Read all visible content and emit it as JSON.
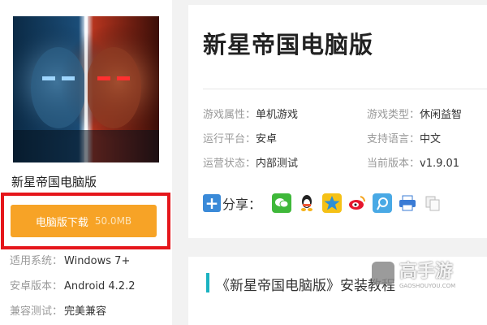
{
  "game": {
    "name_left": "新星帝国电脑版",
    "title": "新星帝国电脑版"
  },
  "download": {
    "label": "电脑版下载",
    "size": "50.0MB"
  },
  "left_info": [
    {
      "key": "适用系统：",
      "value": "Windows 7+"
    },
    {
      "key": "安卓版本：",
      "value": "Android 4.2.2"
    },
    {
      "key": "兼容测试：",
      "value": "完美兼容"
    }
  ],
  "attributes": [
    {
      "key": "游戏属性：",
      "value": "单机游戏"
    },
    {
      "key": "游戏类型：",
      "value": "休闲益智"
    },
    {
      "key": "运行平台：",
      "value": "安卓"
    },
    {
      "key": "支持语言：",
      "value": "中文"
    },
    {
      "key": "运营状态：",
      "value": "内部测试"
    },
    {
      "key": "当前版本：",
      "value": "v1.9.01"
    }
  ],
  "share": {
    "label": "分享：",
    "icons": [
      "wechat-icon",
      "qq-icon",
      "qzone-icon",
      "weibo-icon",
      "tencent-weibo-icon",
      "print-icon",
      "copy-icon"
    ]
  },
  "guide": {
    "title": "《新星帝国电脑版》安装教程"
  },
  "watermark": {
    "cn": "高手游",
    "en": "GAOSHOUYOU.COM"
  },
  "colors": {
    "download_bg": "#f7a326",
    "highlight_border": "#e5161b",
    "accent": "#1ab2c1",
    "share_plus": "#3a8ad8"
  }
}
